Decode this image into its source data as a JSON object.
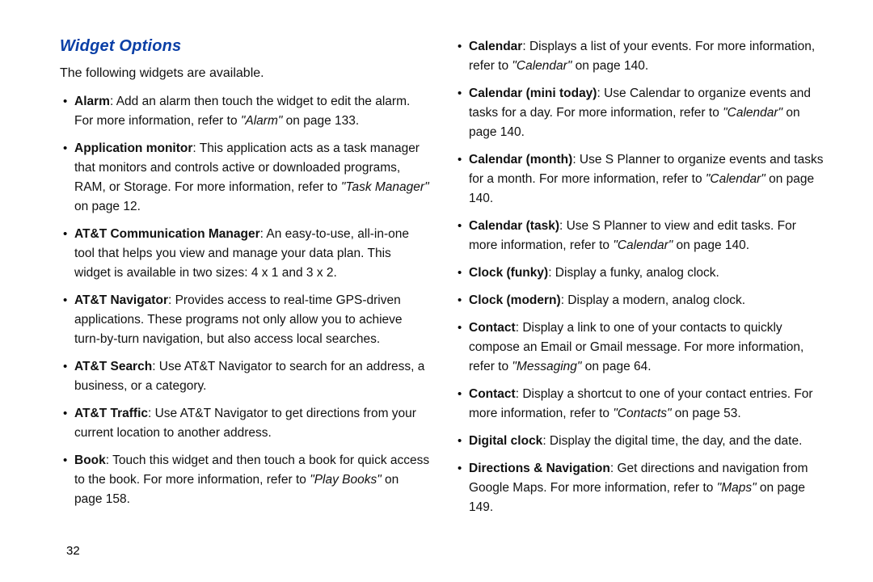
{
  "heading": "Widget Options",
  "intro": "The following widgets are available.",
  "page_number": "32",
  "left": [
    {
      "title": "Alarm",
      "body": ": Add an alarm then touch the widget to edit the alarm. For more information, refer to ",
      "ref": "\"Alarm\"",
      "tail": " on page 133.",
      "style": "loose"
    },
    {
      "title": "Application monitor",
      "body": ": This application acts as a task manager that monitors and controls active or downloaded programs, RAM, or Storage. For more information, refer to ",
      "ref": "\"Task Manager\"",
      "tail": " on page 12.",
      "style": "tight"
    },
    {
      "title": "AT&T Communication Manager",
      "body": ": An easy-to-use, all-in-one tool that helps you view and manage your data plan. This widget is available in two sizes: 4 x 1 and 3 x 2.",
      "ref": "",
      "tail": "",
      "style": "tight"
    },
    {
      "title": "AT&T Navigator",
      "body": ": Provides access to real-time GPS-driven applications. These programs not only allow you to achieve turn-by-turn navigation, but also access local searches.",
      "ref": "",
      "tail": "",
      "style": "tight"
    },
    {
      "title": "AT&T Search",
      "body": ": Use AT&T Navigator to search for an address, a business, or a category.",
      "ref": "",
      "tail": "",
      "style": "tight"
    },
    {
      "title": "AT&T Traffic",
      "body": ": Use AT&T Navigator to get directions from your current location to another address.",
      "ref": "",
      "tail": "",
      "style": "tight"
    },
    {
      "title": "Book",
      "body": ": Touch this widget and then touch a book for quick access to the book. For more information, refer to ",
      "ref": "\"Play Books\"",
      "tail": " on page 158.",
      "style": "tight"
    }
  ],
  "right": [
    {
      "title": "Calendar",
      "body": ": Displays a list of your events. For more information, refer to ",
      "ref": "\"Calendar\"",
      "tail": " on page 140.",
      "style": "loose"
    },
    {
      "title": "Calendar (mini today)",
      "body": ": Use Calendar to organize events and tasks for a day. For more information, refer to ",
      "ref": "\"Calendar\"",
      "tail": " on page 140.",
      "style": "tight"
    },
    {
      "title": "Calendar (month)",
      "body": ": Use S Planner to organize events and tasks for a month. For more information, refer to ",
      "ref": "\"Calendar\"",
      "tail": " on page 140.",
      "style": "tight"
    },
    {
      "title": "Calendar (task)",
      "body": ": Use S Planner to view and edit tasks. For more information, refer to ",
      "ref": "\"Calendar\"",
      "tail": " on page 140.",
      "style": "tight"
    },
    {
      "title": "Clock (funky)",
      "body": ": Display a funky, analog clock.",
      "ref": "",
      "tail": "",
      "style": "loose"
    },
    {
      "title": "Clock (modern)",
      "body": ": Display a modern, analog clock.",
      "ref": "",
      "tail": "",
      "style": "tight"
    },
    {
      "title": "Contact",
      "body": ": Display a link to one of your contacts to quickly compose an Email or Gmail message. For more information, refer to ",
      "ref": "\"Messaging\"",
      "tail": " on page 64.",
      "style": "tight"
    },
    {
      "title": "Contact",
      "body": ": Display a shortcut to one of your contact entries. For more information, refer to ",
      "ref": "\"Contacts\"",
      "tail": " on page 53.",
      "style": "tight"
    },
    {
      "title": "Digital clock",
      "body": ": Display the digital time, the day, and the date.",
      "ref": "",
      "tail": "",
      "style": "tight"
    },
    {
      "title": "Directions & Navigation",
      "body": ": Get directions and navigation from Google Maps. For more information, refer to ",
      "ref": "\"Maps\"",
      "tail": " on page 149.",
      "style": "tight"
    }
  ]
}
